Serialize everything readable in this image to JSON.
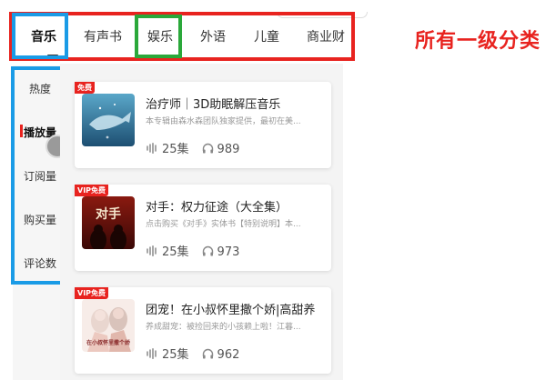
{
  "tabs": [
    {
      "label": "音乐",
      "active": true
    },
    {
      "label": "有声书",
      "active": false
    },
    {
      "label": "娱乐",
      "active": false
    },
    {
      "label": "外语",
      "active": false
    },
    {
      "label": "儿童",
      "active": false
    },
    {
      "label": "商业财",
      "active": false
    }
  ],
  "annotation": "所有一级分类",
  "sidebar": {
    "items": [
      {
        "label": "热度",
        "active": false
      },
      {
        "label": "播放量",
        "active": true
      },
      {
        "label": "订阅量",
        "active": false
      },
      {
        "label": "购买量",
        "active": false
      },
      {
        "label": "评论数",
        "active": false
      }
    ]
  },
  "cards": [
    {
      "badge": "免费",
      "title": "治疗师｜3D助眠解压音乐",
      "desc": "本专辑由森水森团队独家提供，最初在美...",
      "episodes": "25集",
      "plays": "989",
      "cover_text": ""
    },
    {
      "badge": "VIP免费",
      "title": "对手：权力征途（大全集）",
      "desc": "点击购买《对手》实体书【特别说明】本...",
      "episodes": "25集",
      "plays": "973",
      "cover_text": "对手"
    },
    {
      "badge": "VIP免费",
      "title": "团宠！在小叔怀里撒个娇|高甜养",
      "desc": "养成甜宠：被捡回来的小孩赖上啦！江暮...",
      "episodes": "25集",
      "plays": "962",
      "cover_text": "在小叔怀里撒个娇"
    }
  ],
  "colors": {
    "annotation_red": "#e8231f",
    "highlight_blue": "#1a9be6",
    "highlight_green": "#2aa83a",
    "badge_red": "#e8231f"
  }
}
